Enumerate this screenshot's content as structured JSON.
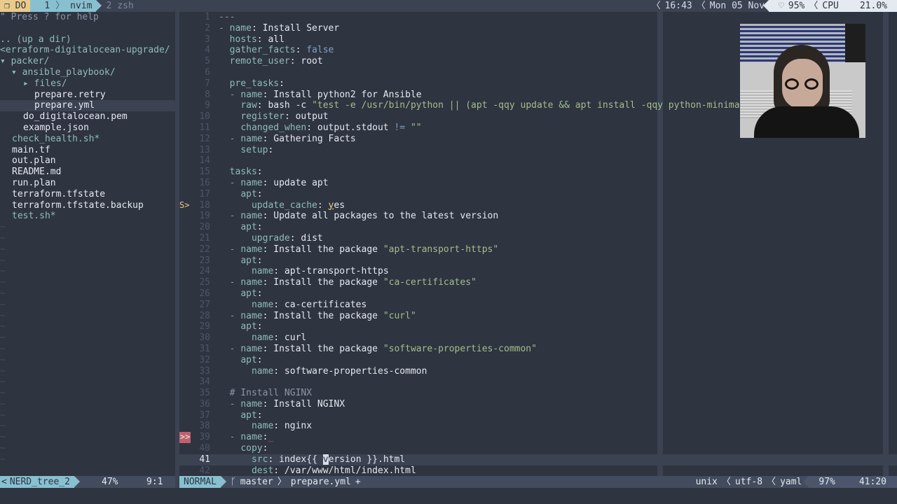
{
  "tmux": {
    "session_icon": "window-icon",
    "session_glyph": "❐",
    "session_name": "DO",
    "windows": [
      {
        "index": "1",
        "name": "nvim",
        "active": true
      },
      {
        "index": "2",
        "name": "zsh",
        "active": false
      }
    ],
    "time": "16:43",
    "date": "Mon 05 Nov",
    "battery_icon": "heart-icon",
    "battery_glyph": "♡",
    "battery": "95%",
    "cpu_label": "CPU",
    "cpu": "21.0%",
    "sep_left": "〈"
  },
  "nerdtree": {
    "help": "\" Press ? for help",
    "up_dir": ".. (up a dir)",
    "root": "<erraform-digitalocean-upgrade/",
    "entries": [
      {
        "text": "▾ packer/",
        "kind": "dir",
        "indent": 0
      },
      {
        "text": "▾ ansible_playbook/",
        "kind": "dir",
        "indent": 1
      },
      {
        "text": "▸ files/",
        "kind": "dir",
        "indent": 2
      },
      {
        "text": "prepare.retry",
        "kind": "file",
        "indent": 3
      },
      {
        "text": "prepare.yml",
        "kind": "file",
        "indent": 3,
        "selected": true
      },
      {
        "text": "do_digitalocean.pem",
        "kind": "file",
        "indent": 2
      },
      {
        "text": "example.json",
        "kind": "file",
        "indent": 2
      },
      {
        "text": "check_health.sh*",
        "kind": "exec",
        "indent": 1
      },
      {
        "text": "main.tf",
        "kind": "file",
        "indent": 1
      },
      {
        "text": "out.plan",
        "kind": "file",
        "indent": 1
      },
      {
        "text": "README.md",
        "kind": "file",
        "indent": 1
      },
      {
        "text": "run.plan",
        "kind": "file",
        "indent": 1
      },
      {
        "text": "terraform.tfstate",
        "kind": "file",
        "indent": 1
      },
      {
        "text": "terraform.tfstate.backup",
        "kind": "file",
        "indent": 1
      },
      {
        "text": "test.sh*",
        "kind": "exec",
        "indent": 1
      }
    ],
    "tilde": "~"
  },
  "editor": {
    "lines": [
      {
        "n": "1",
        "tokens": [
          [
            "d",
            "---"
          ]
        ]
      },
      {
        "n": "2",
        "tokens": [
          [
            "d",
            "- "
          ],
          [
            "k",
            "name"
          ],
          [
            "",
            ": Install Server"
          ]
        ]
      },
      {
        "n": "3",
        "tokens": [
          [
            "",
            "  "
          ],
          [
            "k",
            "hosts"
          ],
          [
            "",
            ": all"
          ]
        ]
      },
      {
        "n": "4",
        "tokens": [
          [
            "",
            "  "
          ],
          [
            "k",
            "gather_facts"
          ],
          [
            "",
            ": "
          ],
          [
            "b",
            "false"
          ]
        ]
      },
      {
        "n": "5",
        "tokens": [
          [
            "",
            "  "
          ],
          [
            "k",
            "remote_user"
          ],
          [
            "",
            ": root"
          ]
        ]
      },
      {
        "n": "6",
        "tokens": []
      },
      {
        "n": "7",
        "tokens": [
          [
            "",
            "  "
          ],
          [
            "k",
            "pre_tasks"
          ],
          [
            "",
            ":"
          ]
        ]
      },
      {
        "n": "8",
        "tokens": [
          [
            "",
            "  "
          ],
          [
            "d",
            "- "
          ],
          [
            "k",
            "name"
          ],
          [
            "",
            ": Install python2 for Ansible"
          ]
        ]
      },
      {
        "n": "9",
        "tokens": [
          [
            "",
            "    "
          ],
          [
            "k",
            "raw"
          ],
          [
            "",
            ": bash -c "
          ],
          [
            "s",
            "\"test -e /usr/bin/python || (apt -qqy update && apt install -qqy python-minimal)\""
          ]
        ]
      },
      {
        "n": "10",
        "tokens": [
          [
            "",
            "    "
          ],
          [
            "k",
            "register"
          ],
          [
            "",
            ": output"
          ]
        ]
      },
      {
        "n": "11",
        "tokens": [
          [
            "",
            "    "
          ],
          [
            "k",
            "changed_when"
          ],
          [
            "",
            ": output.stdout "
          ],
          [
            "b",
            "!="
          ],
          [
            "",
            " "
          ],
          [
            "s",
            "\"\""
          ]
        ]
      },
      {
        "n": "12",
        "tokens": [
          [
            "",
            "  "
          ],
          [
            "d",
            "- "
          ],
          [
            "k",
            "name"
          ],
          [
            "",
            ": Gathering Facts"
          ]
        ]
      },
      {
        "n": "13",
        "tokens": [
          [
            "",
            "    "
          ],
          [
            "k",
            "setup"
          ],
          [
            "",
            ":"
          ]
        ]
      },
      {
        "n": "14",
        "tokens": []
      },
      {
        "n": "15",
        "tokens": [
          [
            "",
            "  "
          ],
          [
            "k",
            "tasks"
          ],
          [
            "",
            ":"
          ]
        ]
      },
      {
        "n": "16",
        "tokens": [
          [
            "",
            "  "
          ],
          [
            "d",
            "- "
          ],
          [
            "k",
            "name"
          ],
          [
            "",
            ": update apt"
          ]
        ]
      },
      {
        "n": "17",
        "tokens": [
          [
            "",
            "    "
          ],
          [
            "k",
            "apt"
          ],
          [
            "",
            ":"
          ]
        ]
      },
      {
        "n": "18",
        "sign": "S>",
        "tokens": [
          [
            "",
            "      "
          ],
          [
            "k",
            "update_cache"
          ],
          [
            "",
            ": "
          ],
          [
            "u",
            "y"
          ],
          [
            "",
            "es"
          ]
        ]
      },
      {
        "n": "19",
        "tokens": [
          [
            "",
            "  "
          ],
          [
            "d",
            "- "
          ],
          [
            "k",
            "name"
          ],
          [
            "",
            ": Update all packages to the latest version"
          ]
        ]
      },
      {
        "n": "20",
        "tokens": [
          [
            "",
            "    "
          ],
          [
            "k",
            "apt"
          ],
          [
            "",
            ":"
          ]
        ]
      },
      {
        "n": "21",
        "tokens": [
          [
            "",
            "      "
          ],
          [
            "k",
            "upgrade"
          ],
          [
            "",
            ": dist"
          ]
        ]
      },
      {
        "n": "22",
        "tokens": [
          [
            "",
            "  "
          ],
          [
            "d",
            "- "
          ],
          [
            "k",
            "name"
          ],
          [
            "",
            ": Install the package "
          ],
          [
            "s",
            "\"apt-transport-https\""
          ]
        ]
      },
      {
        "n": "23",
        "tokens": [
          [
            "",
            "    "
          ],
          [
            "k",
            "apt"
          ],
          [
            "",
            ":"
          ]
        ]
      },
      {
        "n": "24",
        "tokens": [
          [
            "",
            "      "
          ],
          [
            "k",
            "name"
          ],
          [
            "",
            ": apt-transport-https"
          ]
        ]
      },
      {
        "n": "25",
        "tokens": [
          [
            "",
            "  "
          ],
          [
            "d",
            "- "
          ],
          [
            "k",
            "name"
          ],
          [
            "",
            ": Install the package "
          ],
          [
            "s",
            "\"ca-certificates\""
          ]
        ]
      },
      {
        "n": "26",
        "tokens": [
          [
            "",
            "    "
          ],
          [
            "k",
            "apt"
          ],
          [
            "",
            ":"
          ]
        ]
      },
      {
        "n": "27",
        "tokens": [
          [
            "",
            "      "
          ],
          [
            "k",
            "name"
          ],
          [
            "",
            ": ca-certificates"
          ]
        ]
      },
      {
        "n": "28",
        "tokens": [
          [
            "",
            "  "
          ],
          [
            "d",
            "- "
          ],
          [
            "k",
            "name"
          ],
          [
            "",
            ": Install the package "
          ],
          [
            "s",
            "\"curl\""
          ]
        ]
      },
      {
        "n": "29",
        "tokens": [
          [
            "",
            "    "
          ],
          [
            "k",
            "apt"
          ],
          [
            "",
            ":"
          ]
        ]
      },
      {
        "n": "30",
        "tokens": [
          [
            "",
            "      "
          ],
          [
            "k",
            "name"
          ],
          [
            "",
            ": curl"
          ]
        ]
      },
      {
        "n": "31",
        "tokens": [
          [
            "",
            "  "
          ],
          [
            "d",
            "- "
          ],
          [
            "k",
            "name"
          ],
          [
            "",
            ": Install the package "
          ],
          [
            "s",
            "\"software-properties-common\""
          ]
        ]
      },
      {
        "n": "32",
        "tokens": [
          [
            "",
            "    "
          ],
          [
            "k",
            "apt"
          ],
          [
            "",
            ":"
          ]
        ]
      },
      {
        "n": "33",
        "tokens": [
          [
            "",
            "      "
          ],
          [
            "k",
            "name"
          ],
          [
            "",
            ": software-properties-common"
          ]
        ]
      },
      {
        "n": "34",
        "tokens": []
      },
      {
        "n": "35",
        "tokens": [
          [
            "",
            "  "
          ],
          [
            "c",
            "# Install NGINX"
          ]
        ]
      },
      {
        "n": "36",
        "tokens": [
          [
            "",
            "  "
          ],
          [
            "d",
            "- "
          ],
          [
            "k",
            "name"
          ],
          [
            "",
            ": Install NGINX"
          ]
        ]
      },
      {
        "n": "37",
        "tokens": [
          [
            "",
            "    "
          ],
          [
            "k",
            "apt"
          ],
          [
            "",
            ":"
          ]
        ]
      },
      {
        "n": "38",
        "tokens": [
          [
            "",
            "      "
          ],
          [
            "k",
            "name"
          ],
          [
            "",
            ": nginx"
          ]
        ]
      },
      {
        "n": "39",
        "sign": ">>",
        "sign_error": true,
        "tokens": [
          [
            "",
            "  "
          ],
          [
            "d",
            "- "
          ],
          [
            "k",
            "name"
          ],
          [
            "",
            ":"
          ],
          [
            "err",
            "_"
          ]
        ]
      },
      {
        "n": "40",
        "tokens": [
          [
            "",
            "    "
          ],
          [
            "k",
            "copy"
          ],
          [
            "",
            ":"
          ]
        ]
      },
      {
        "n": "41",
        "current": true,
        "tokens": [
          [
            "",
            "      "
          ],
          [
            "k",
            "src"
          ],
          [
            "",
            ": index{{ "
          ],
          [
            "cur",
            "v"
          ],
          [
            "",
            "ersion }}.html"
          ]
        ]
      },
      {
        "n": "42",
        "tokens": [
          [
            "",
            "      "
          ],
          [
            "k",
            "dest"
          ],
          [
            "",
            ": /var/www/html/index.html"
          ]
        ]
      }
    ]
  },
  "statusline": {
    "nerdtree_name": "NERD_tree_2",
    "nerdtree_prefix": "<",
    "nerdtree_percent": "47%",
    "nerdtree_pos": "9:1",
    "mode": "NORMAL",
    "branch_icon": "git-branch-icon",
    "branch_glyph": "ᚴ",
    "branch": "master",
    "sep": "〉",
    "filename": "prepare.yml",
    "modified": "+",
    "fileformat": "unix",
    "encoding": "utf-8",
    "filetype": "yaml",
    "sep_left": "〈",
    "percent": "97%",
    "position": "41:20"
  },
  "webcam": {
    "label": "presenter-webcam-overlay"
  }
}
